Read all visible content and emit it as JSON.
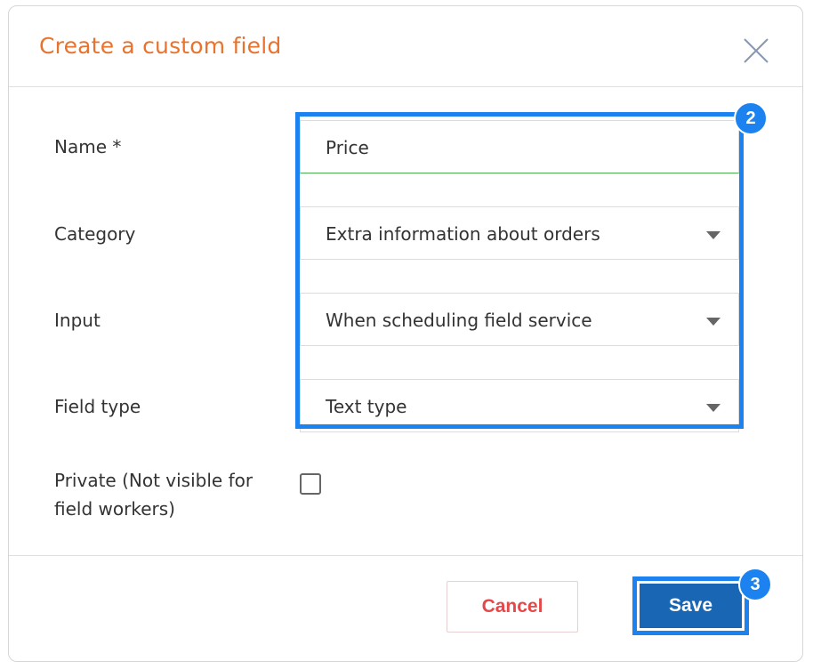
{
  "dialog": {
    "title": "Create a custom field",
    "close_icon": "close-icon"
  },
  "form": {
    "name": {
      "label": "Name *",
      "value": "Price"
    },
    "category": {
      "label": "Category",
      "value": "Extra information about orders"
    },
    "input": {
      "label": "Input",
      "value": "When scheduling field service"
    },
    "field_type": {
      "label": "Field type",
      "value": "Text type"
    },
    "private": {
      "label_line1": "Private (Not visible for",
      "label_line2": "field workers)",
      "checked": false
    }
  },
  "footer": {
    "cancel_label": "Cancel",
    "save_label": "Save"
  },
  "annotations": {
    "badge_fields": "2",
    "badge_save": "3"
  },
  "colors": {
    "title": "#e8732c",
    "highlight": "#1b82f0",
    "save_bg": "#1966b5",
    "cancel_text": "#e54848"
  }
}
